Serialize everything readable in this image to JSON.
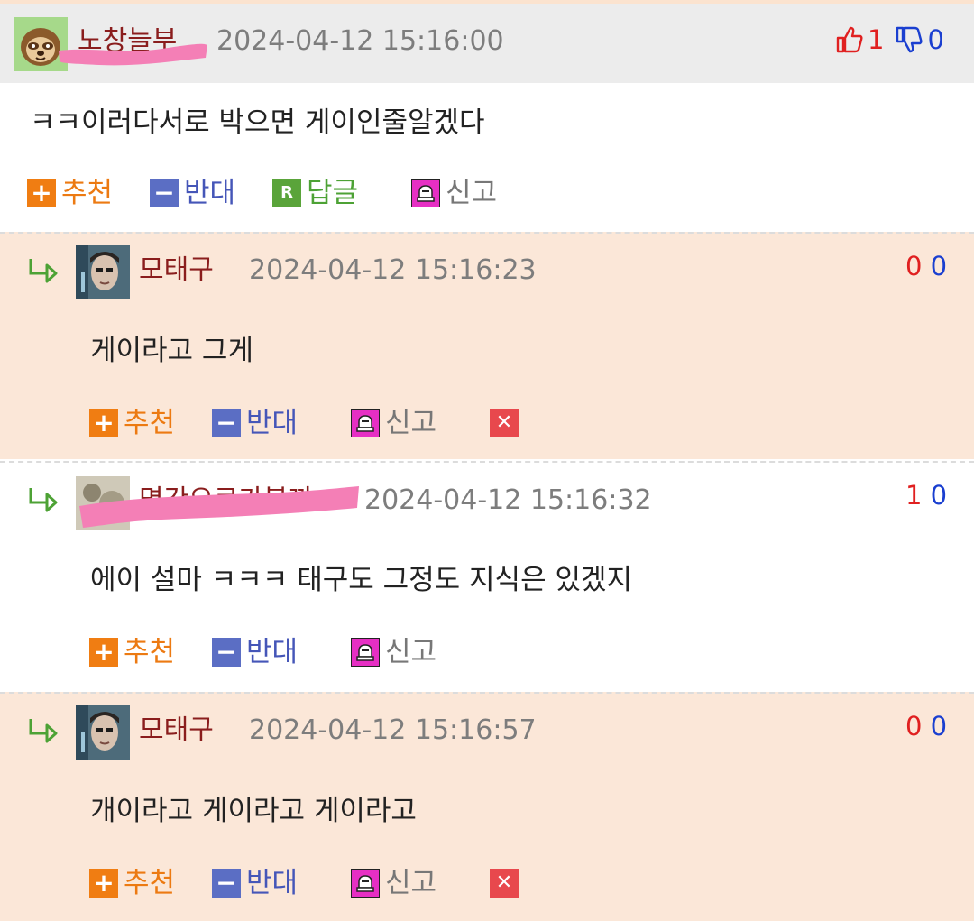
{
  "main_comment": {
    "author": "노창늘부",
    "date": "2024-04-12 15:16:00",
    "up_count": "1",
    "down_count": "0",
    "text": "ㅋㅋ이러다서로 박으면 게이인줄알겠다"
  },
  "actions": {
    "recommend": "추천",
    "oppose": "반대",
    "reply": "답글",
    "report": "신고",
    "reply_box": "R"
  },
  "replies": [
    {
      "author": "모태구",
      "date": "2024-04-12 15:16:23",
      "up": "0",
      "down": "0",
      "text": "게이라고 그게"
    },
    {
      "author": "명간으로가볼까",
      "date": "2024-04-12 15:16:32",
      "up": "1",
      "down": "0",
      "text": "에이 설마 ㅋㅋㅋ 태구도 그정도 지식은 있겠지"
    },
    {
      "author": "모태구",
      "date": "2024-04-12 15:16:57",
      "up": "0",
      "down": "0",
      "text": "개이라고 게이라고 게이라고"
    }
  ],
  "colors": {
    "author": "#8a1d1d",
    "up": "#e02020",
    "down": "#1a3fd0",
    "peach_bg": "#fbe7d8",
    "header_bg": "#ececec",
    "censor_scribble": "#f47fb6"
  },
  "icons": [
    "sloth-avatar",
    "thumbs-up-icon",
    "thumbs-down-icon",
    "plus-icon",
    "minus-icon",
    "reply-r-icon",
    "siren-icon",
    "delete-x-icon",
    "reply-arrow-icon"
  ]
}
